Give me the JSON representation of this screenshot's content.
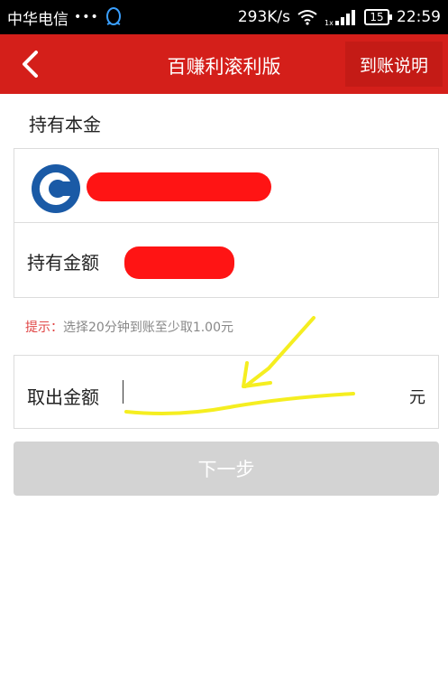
{
  "status_bar": {
    "carrier": "中华电信",
    "dots": "•••",
    "speed": "293K/s",
    "battery": "15",
    "time": "22:59"
  },
  "nav": {
    "title": "百赚利滚利版",
    "right_button": "到账说明"
  },
  "section_title": "持有本金",
  "card": {
    "holding_amount_label": "持有金额"
  },
  "tip": {
    "key": "提示：",
    "text": "选择20分钟到账至少取1.00元"
  },
  "withdraw": {
    "label": "取出金额",
    "value": "",
    "placeholder": "",
    "unit": "元"
  },
  "next_button": "下一步",
  "colors": {
    "nav_red": "#d41f1a",
    "redaction_red": "#ff1414",
    "tip_red": "#e04545",
    "annotation_yellow": "#f5ee20",
    "bank_blue": "#1a5aa6",
    "disabled_button": "#d3d3d3"
  },
  "icons": {
    "back": "chevron-left-icon",
    "qq": "qq-penguin-icon",
    "wifi": "wifi-icon",
    "signal": "signal-icon",
    "bank": "ccb-bank-logo"
  }
}
